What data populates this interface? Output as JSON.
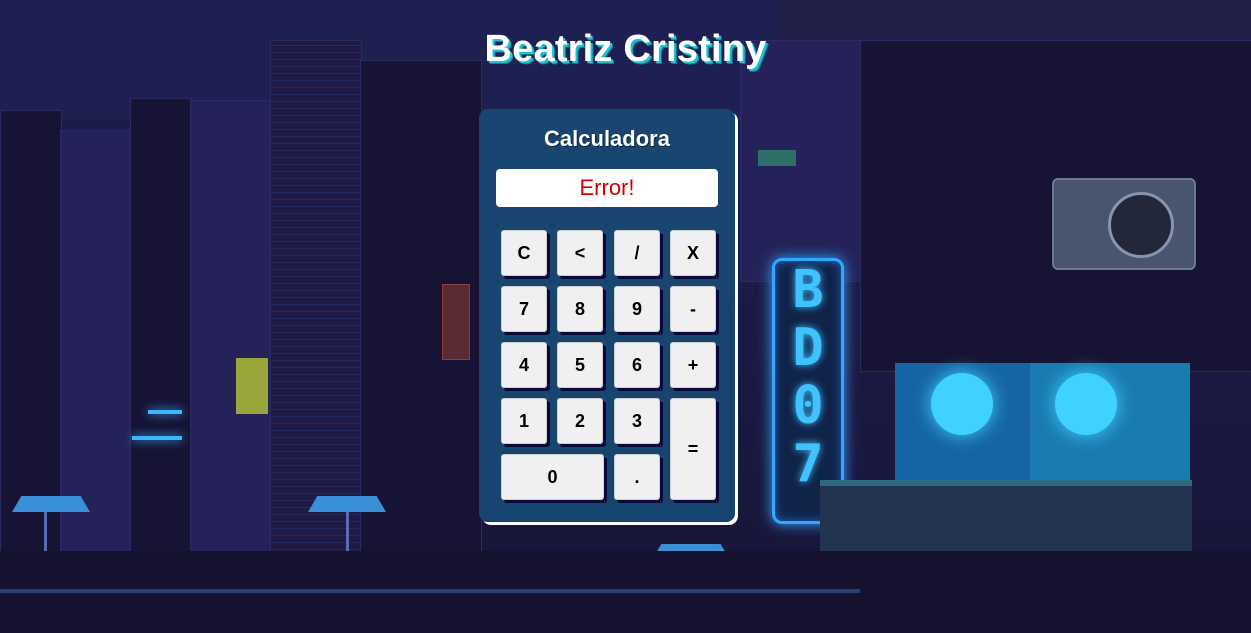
{
  "page": {
    "title": "Beatriz Cristiny"
  },
  "calculator": {
    "title": "Calculadora",
    "display_value": "Error!",
    "display_color": "#d40000",
    "panel_color": "#184e78",
    "keys": {
      "clear": "C",
      "backspace": "<",
      "divide": "/",
      "multiply": "X",
      "seven": "7",
      "eight": "8",
      "nine": "9",
      "subtract": "-",
      "four": "4",
      "five": "5",
      "six": "6",
      "add": "+",
      "one": "1",
      "two": "2",
      "three": "3",
      "equals": "=",
      "zero": "0",
      "decimal": "."
    }
  },
  "background": {
    "neon_sign": [
      "B",
      "D",
      "0",
      "7"
    ]
  }
}
